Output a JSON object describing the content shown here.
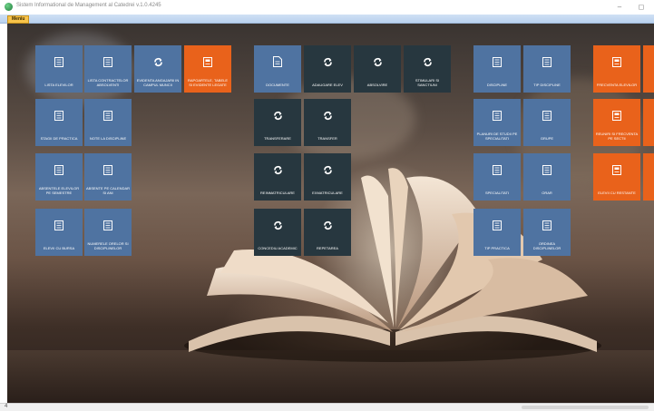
{
  "window": {
    "title": "Sistem Informational de Management al Catedrei v.1.0.4245",
    "minimize": "–",
    "maximize": "◻"
  },
  "ribbon": {
    "menu_tab": "Meniu"
  },
  "tiles": [
    {
      "id": "lista-elevilor",
      "label": "LISTA ELEVILOR",
      "color": "blue",
      "icon": "list-icon"
    },
    {
      "id": "lista-absolventi",
      "label": "LISTA CONTRACTELOR ABSOLVENTI",
      "color": "blue",
      "icon": "list-icon"
    },
    {
      "id": "evidenta-ocupare",
      "label": "EVIDENTA ANGAJARII IN CAMPUL MUNCII",
      "color": "blue",
      "icon": "refresh-icon"
    },
    {
      "id": "rapoartele",
      "label": "RAPOARTELE, TABELE SI EVIDENTE LEGATE",
      "color": "orange",
      "icon": "document-icon"
    },
    {
      "id": "stagii-practica",
      "label": "STAGII DE PRACTICA",
      "color": "blue",
      "icon": "list-icon"
    },
    {
      "id": "note-discipline",
      "label": "NOTE LA DISCIPLINE",
      "color": "blue",
      "icon": "list-icon"
    },
    {
      "id": "absente-semestre",
      "label": "ABSENTELE ELEVILOR PE SEMESTRE",
      "color": "blue",
      "icon": "list-icon"
    },
    {
      "id": "absente-ani",
      "label": "ABSENTE PE CALENDAR SI ANI",
      "color": "blue",
      "icon": "list-icon"
    },
    {
      "id": "elevi-bursa",
      "label": "ELEVII CU BURSA",
      "color": "blue",
      "icon": "list-icon"
    },
    {
      "id": "numerele-disciplinelor",
      "label": "NUMERELE ORELOR SI DISCIPLINELOR",
      "color": "blue",
      "icon": "list-icon"
    },
    {
      "id": "documente",
      "label": "DOCUMENTE",
      "color": "blue",
      "icon": "file-icon"
    },
    {
      "id": "adaugare-elev",
      "label": "ADAUGARE ELEV",
      "color": "dark",
      "icon": "refresh-icon"
    },
    {
      "id": "absolvire",
      "label": "ABSOLVIRE",
      "color": "dark",
      "icon": "refresh-icon"
    },
    {
      "id": "stimulari",
      "label": "STIMULARI SI SANCTIUNI",
      "color": "dark",
      "icon": "refresh-icon"
    },
    {
      "id": "transferare",
      "label": "TRANSFERARE",
      "color": "dark",
      "icon": "refresh-icon"
    },
    {
      "id": "transfer",
      "label": "TRANSFER",
      "color": "dark",
      "icon": "refresh-icon"
    },
    {
      "id": "reinmatriculare",
      "label": "REINMATRICULARE",
      "color": "dark",
      "icon": "refresh-icon"
    },
    {
      "id": "exmatriculare",
      "label": "EXMATRICULARE",
      "color": "dark",
      "icon": "refresh-icon"
    },
    {
      "id": "concediu-academic",
      "label": "CONCEDIU ACADEMIC",
      "color": "dark",
      "icon": "refresh-icon"
    },
    {
      "id": "repetare",
      "label": "REPETAREA",
      "color": "dark",
      "icon": "refresh-icon"
    },
    {
      "id": "discipline",
      "label": "DISCIPLINE",
      "color": "blue",
      "icon": "list-icon"
    },
    {
      "id": "tip-discipline",
      "label": "TIP DISCIPLINE",
      "color": "blue",
      "icon": "list-icon"
    },
    {
      "id": "planuri-studii",
      "label": "PLANURI DE STUDII PE SPECIALITATI",
      "color": "blue",
      "icon": "list-icon"
    },
    {
      "id": "grupe",
      "label": "GRUPE",
      "color": "blue",
      "icon": "list-icon"
    },
    {
      "id": "specialitati",
      "label": "SPECIALITATI",
      "color": "blue",
      "icon": "list-icon"
    },
    {
      "id": "orar",
      "label": "ORAR",
      "color": "blue",
      "icon": "list-icon"
    },
    {
      "id": "tip-practica",
      "label": "TIP PRACTICA",
      "color": "blue",
      "icon": "list-icon"
    },
    {
      "id": "ordinea-disciplinelor",
      "label": "ORDINEA DISCIPLINELOR",
      "color": "blue",
      "icon": "list-icon"
    },
    {
      "id": "frecventa-elevilor",
      "label": "FRECVENTA ELEVILOR",
      "color": "orange",
      "icon": "document-icon"
    },
    {
      "id": "frecventa-grupe",
      "label": "",
      "color": "orange",
      "icon": "document-icon"
    },
    {
      "id": "reuniri-frecventa",
      "label": "REUNIRI SI FRECVENTA PE SECTII",
      "color": "orange",
      "icon": "document-icon"
    },
    {
      "id": "reuniri-partial",
      "label": "",
      "color": "orange",
      "icon": "document-icon"
    },
    {
      "id": "elevii-restanta",
      "label": "ELEVII CU RESTANTE",
      "color": "orange",
      "icon": "document-icon"
    },
    {
      "id": "elevii-restanta-partial",
      "label": "",
      "color": "orange",
      "icon": "document-icon"
    }
  ],
  "status": {
    "text": "4"
  }
}
